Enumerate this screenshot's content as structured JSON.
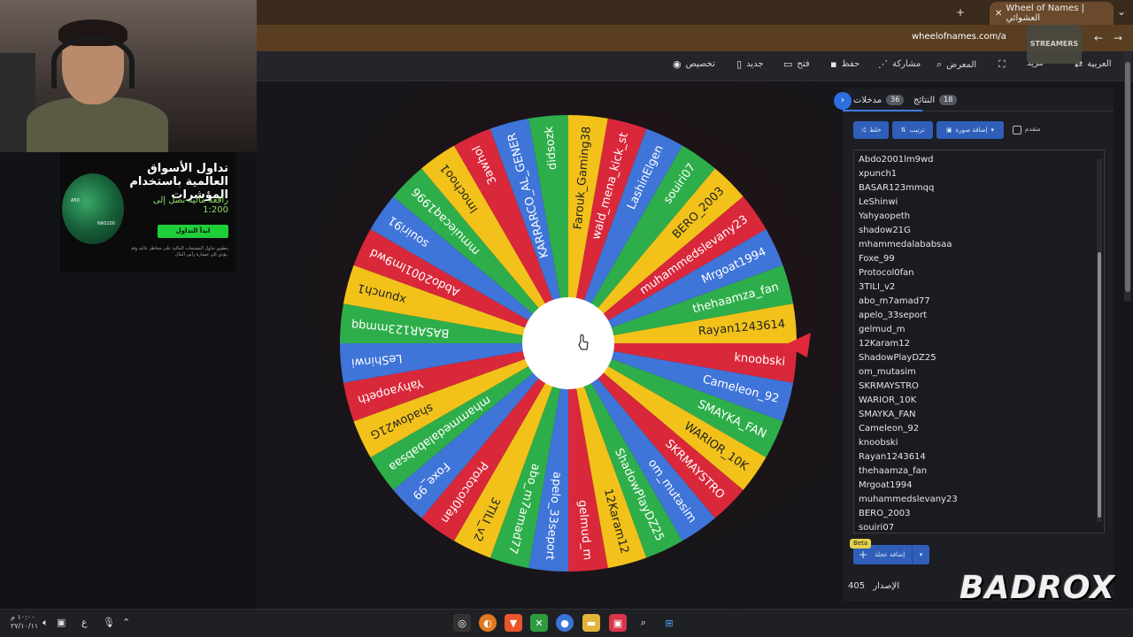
{
  "browser": {
    "tab_title": "Wheel of Names | العشوائي",
    "url": "wheelofnames.com/a",
    "new_tab_symbol": "+",
    "close_symbol": "✕"
  },
  "toolbar": {
    "language": "العربية",
    "more": "مزيد",
    "fullscreen": "",
    "gallery": "المعرض",
    "share": "مشاركة",
    "save": "حفظ",
    "open": "فتح",
    "new": "جديد",
    "customize": "تخصيص"
  },
  "ad": {
    "title": "تداول الأسواق العالمية باستخدام المؤشرات",
    "subtitle": "رافعة مالية تصل إلى 1:200",
    "button": "ابدأ التداول",
    "fine_print": "ينطوي تداول المشتقات المالية على مخاطر عالية وقد يؤدي إلى خسارة رأس المال.",
    "labels": [
      "A50",
      "NAS100"
    ]
  },
  "wheel": {
    "segments": [
      "knoobski",
      "Cameleon_92",
      "SMAYKA_FAN",
      "WARIOR_10K",
      "SKRMAYSTRO",
      "om_mutasim",
      "ShadowPlayDZ25",
      "12Karam12",
      "gelmud_m",
      "apelo_33seport",
      "abo_m7amad77",
      "3TILI_v2",
      "Protocol0fan",
      "Foxe_99",
      "mhammedalababsaa",
      "shadow21G",
      "Yahyaopeth",
      "LeShinwi",
      "BASAR123mmqq",
      "xpunch1",
      "Abdo2001lm9wd",
      "souiri91",
      "mmuiecaq1996",
      "lmochoo1",
      "3awhol",
      "KARRARCO_AL_GENER",
      "didsozk",
      "Farouk_Gaming38",
      "wald_mena_kick_st",
      "LashinElgen",
      "souiri07",
      "BERO_2003",
      "muhammedslevany23",
      "Mrgoat1994",
      "thehaamza_fan",
      "Rayan1243614"
    ],
    "colors": [
      "#d9283a",
      "#3f74d8",
      "#2eae4a",
      "#f2c21b"
    ]
  },
  "panel": {
    "entries_tab": "مدخلات",
    "entries_count": "36",
    "results_tab": "النتائج",
    "results_count": "18",
    "shuffle": "خلط",
    "sort": "ترتيب",
    "add_image": "إضافة صورة",
    "advanced": "متقدم",
    "entries": [
      "Abdo2001lm9wd",
      "xpunch1",
      "BASAR123mmqq",
      "LeShinwi",
      "Yahyaopeth",
      "shadow21G",
      "mhammedalababsaa",
      "Foxe_99",
      "Protocol0fan",
      "3TILI_v2",
      "abo_m7amad77",
      "apelo_33seport",
      "gelmud_m",
      "12Karam12",
      "ShadowPlayDZ25",
      "om_mutasim",
      "SKRMAYSTRO",
      "WARIOR_10K",
      "SMAYKA_FAN",
      "Cameleon_92",
      "knoobski",
      "Rayan1243614",
      "thehaamza_fan",
      "Mrgoat1994",
      "muhammedslevany23",
      "BERO_2003",
      "souiri07"
    ],
    "beta": "Beta",
    "add_wheel": "إضافة عجلة",
    "version_label": "الإصدار",
    "version_number": "405"
  },
  "overlay": {
    "logo": "BADROX",
    "streamers": "STREAMERS"
  },
  "taskbar": {
    "clock_time": "١٠:٠٠ م",
    "clock_date": "٢٧/١٠/١١",
    "lang": "ع"
  }
}
